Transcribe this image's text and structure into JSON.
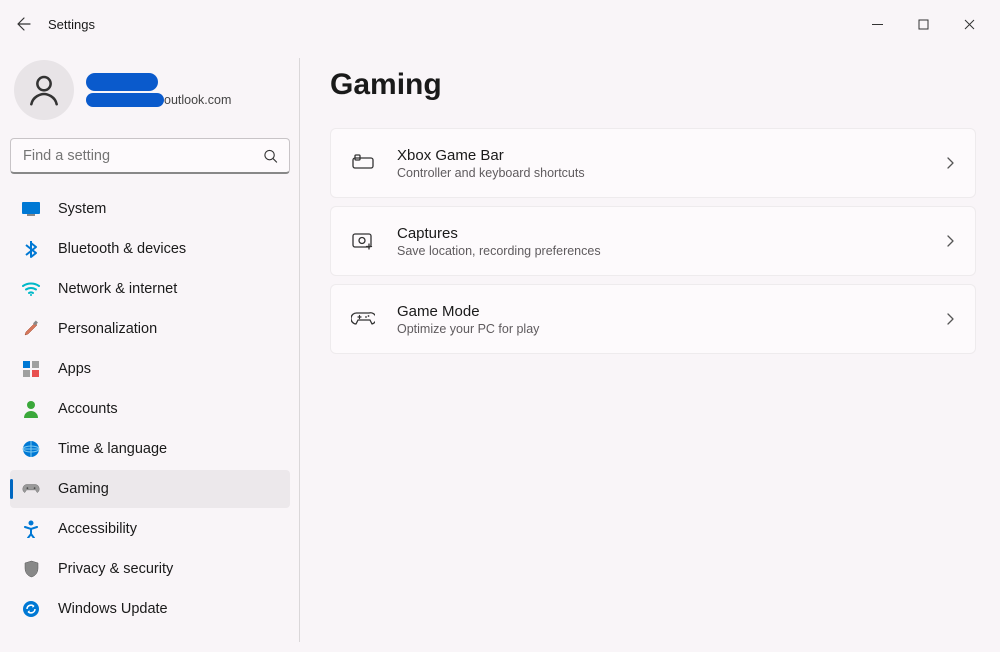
{
  "window": {
    "title": "Settings"
  },
  "profile": {
    "email_visible": "outlook.com"
  },
  "search": {
    "placeholder": "Find a setting"
  },
  "nav": {
    "items": [
      {
        "label": "System"
      },
      {
        "label": "Bluetooth & devices"
      },
      {
        "label": "Network & internet"
      },
      {
        "label": "Personalization"
      },
      {
        "label": "Apps"
      },
      {
        "label": "Accounts"
      },
      {
        "label": "Time & language"
      },
      {
        "label": "Gaming"
      },
      {
        "label": "Accessibility"
      },
      {
        "label": "Privacy & security"
      },
      {
        "label": "Windows Update"
      }
    ]
  },
  "page": {
    "title": "Gaming"
  },
  "tiles": [
    {
      "title": "Xbox Game Bar",
      "sub": "Controller and keyboard shortcuts"
    },
    {
      "title": "Captures",
      "sub": "Save location, recording preferences"
    },
    {
      "title": "Game Mode",
      "sub": "Optimize your PC for play"
    }
  ]
}
